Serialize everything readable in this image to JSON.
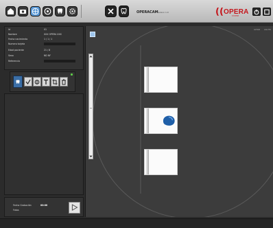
{
  "toolbar": {
    "buttons": [
      "home-icon",
      "camera-icon",
      "globe-icon",
      "disc-icon",
      "tooth-icon",
      "settings-icon"
    ],
    "brand": "OPERACAM",
    "brand_sub": "version 1.0",
    "logo": "OPERA",
    "logo_sub": "SYSTEM"
  },
  "info": {
    "id_label": "Id",
    "id_value": "01",
    "name_label": "Nombre",
    "name_value": "XXX OPERA XXX",
    "birth_label": "Fecha nacimiento",
    "birth_value": "1 / 1 / 1",
    "note_label": "Numero tarjeta",
    "age_label": "Edad paciente",
    "age_value": "21 / 8",
    "sex_label": "Sexo",
    "sex_value": "ND   NF",
    "ref_label": "Referencia"
  },
  "viewer": {
    "right_labels": [
      "ALTAR",
      "AGUTA"
    ]
  },
  "footer": {
    "date_label": "Fecha Grabación",
    "date_value": "00:00",
    "foto_label": "Fotos"
  },
  "colors": {
    "accent": "#5b9ad8",
    "logo_red": "#c4141a",
    "tooth_blue": "#1f5fa8"
  }
}
